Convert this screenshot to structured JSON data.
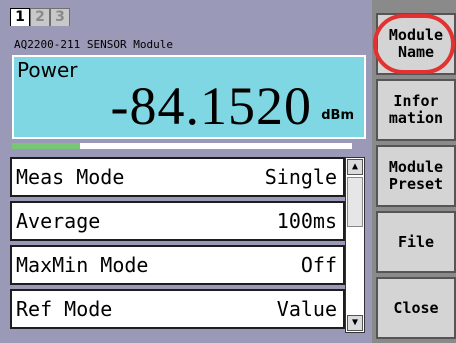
{
  "tabs": [
    "1",
    "2",
    "3"
  ],
  "active_tab": "1",
  "module": {
    "title": "AQ2200-211 SENSOR Module"
  },
  "power": {
    "label": "Power",
    "value": "-84.1520",
    "unit": "dBm",
    "level_fraction": 0.2
  },
  "settings": [
    {
      "label": "Meas Mode",
      "value": "Single"
    },
    {
      "label": "Average",
      "value": "100ms"
    },
    {
      "label": "MaxMin Mode",
      "value": "Off"
    },
    {
      "label": "Ref Mode",
      "value": "Value"
    }
  ],
  "scrollbar": {
    "up_icon": "▲",
    "down_icon": "▼"
  },
  "softkeys": [
    {
      "label": "Module\nName",
      "highlighted": true
    },
    {
      "label": "Infor\nmation"
    },
    {
      "label": "Module\nPreset"
    },
    {
      "label": "File"
    },
    {
      "label": "Close"
    }
  ],
  "colors": {
    "power_bg": "#7fd7e3",
    "panel_bg": "#9a9ab8",
    "highlight": "#e33030"
  }
}
